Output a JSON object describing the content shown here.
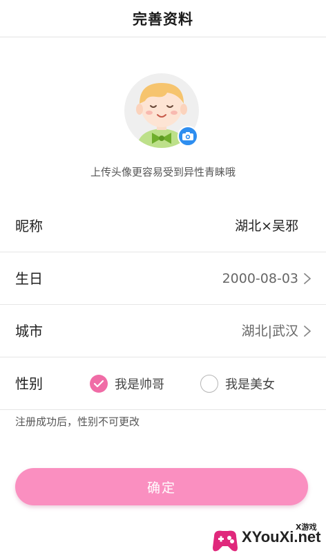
{
  "header": {
    "title": "完善资料"
  },
  "avatar": {
    "upload_hint": "上传头像更容易受到异性青睐哦",
    "camera_badge_color": "#2e8ef0"
  },
  "form": {
    "nickname": {
      "label": "昵称",
      "value": "湖北×吴邪"
    },
    "birthday": {
      "label": "生日",
      "value": "2000-08-03"
    },
    "city": {
      "label": "城市",
      "value": "湖北|武汉"
    },
    "gender": {
      "label": "性别",
      "options": [
        {
          "label": "我是帅哥",
          "selected": true
        },
        {
          "label": "我是美女",
          "selected": false
        }
      ]
    }
  },
  "note": "注册成功后，性别不可更改",
  "confirm_button": {
    "label": "确定",
    "color": "#fa8fc0"
  },
  "watermark": {
    "brand": "XYouXi.net",
    "small": "X游戏"
  }
}
